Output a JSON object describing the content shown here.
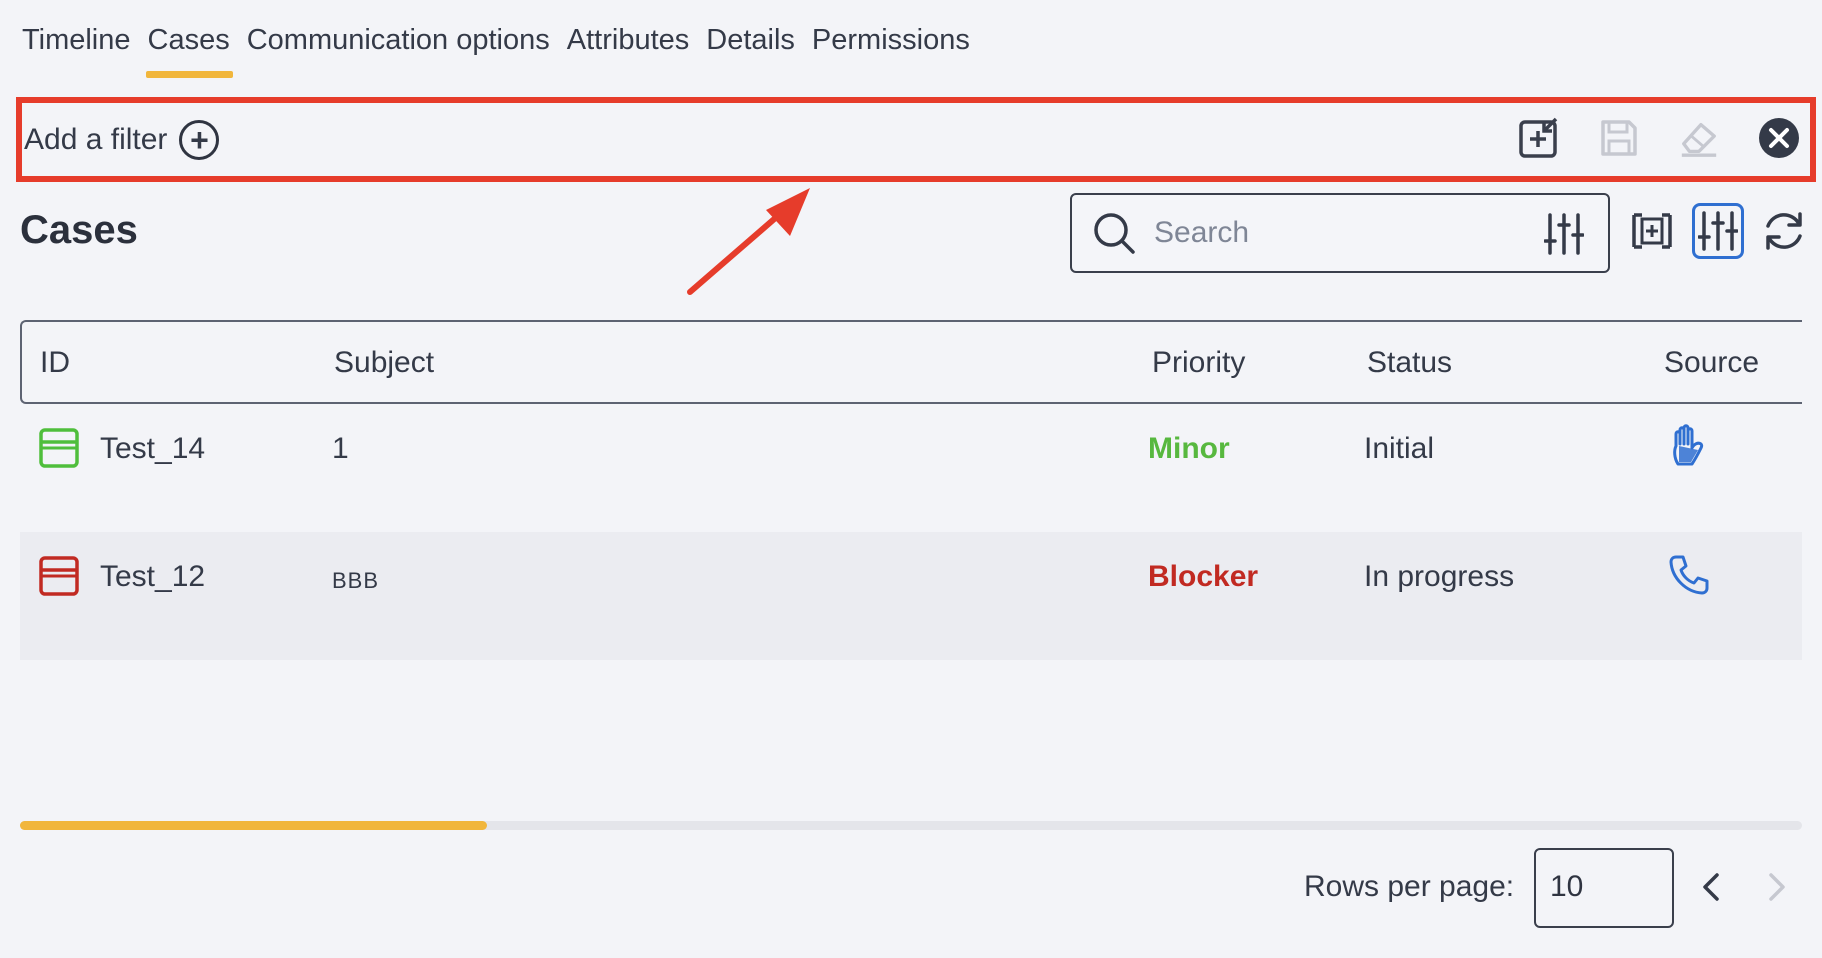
{
  "tabs": [
    {
      "label": "Timeline"
    },
    {
      "label": "Cases"
    },
    {
      "label": "Communication options"
    },
    {
      "label": "Attributes"
    },
    {
      "label": "Details"
    },
    {
      "label": "Permissions"
    }
  ],
  "active_tab": "Cases",
  "filter": {
    "add_label": "Add a filter",
    "actions": [
      "add-to-filter-icon",
      "save-icon",
      "eraser-icon",
      "close-icon"
    ]
  },
  "cases": {
    "title": "Cases",
    "search_placeholder": "Search",
    "columns": [
      "ID",
      "Subject",
      "Priority",
      "Status",
      "Source"
    ],
    "rows": [
      {
        "id": "Test_14",
        "subject": "1",
        "priority": "Minor",
        "status": "Initial",
        "source_icon": "hand-icon",
        "folder_color": "#4fbe3c"
      },
      {
        "id": "Test_12",
        "subject": "BBB",
        "priority": "Blocker",
        "status": "In progress",
        "source_icon": "phone-icon",
        "folder_color": "#c12a22"
      }
    ]
  },
  "pagination": {
    "rows_per_page_label": "Rows per page:",
    "rows_per_page_value": "10"
  },
  "colors": {
    "accent": "#f1b63c",
    "highlight": "#e63c2b",
    "link_blue": "#2f6fd1",
    "minor": "#57b83f",
    "blocker": "#c12a22"
  }
}
